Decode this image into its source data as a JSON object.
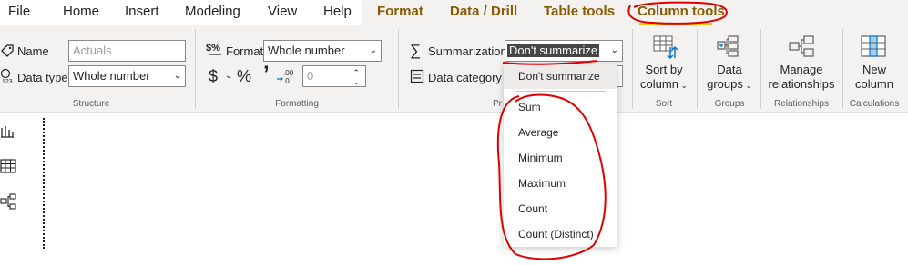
{
  "menu": {
    "tabs": [
      {
        "label": "File"
      },
      {
        "label": "Home"
      },
      {
        "label": "Insert"
      },
      {
        "label": "Modeling"
      },
      {
        "label": "View"
      },
      {
        "label": "Help"
      },
      {
        "label": "Format"
      },
      {
        "label": "Data / Drill"
      },
      {
        "label": "Table tools"
      },
      {
        "label": "Column tools"
      }
    ]
  },
  "structure": {
    "name_label": "Name",
    "name_value": "Actuals",
    "datatype_label": "Data type",
    "datatype_value": "Whole number",
    "group_label": "Structure"
  },
  "formatting": {
    "format_label": "Format",
    "format_value": "Whole number",
    "currency_symbol": "$",
    "percent_symbol": "%",
    "comma_symbol": "’",
    "decimal_symbol": ".00",
    "decimals_value": "0",
    "group_label": "Formatting"
  },
  "properties": {
    "summarization_label": "Summarization",
    "summarization_value": "Don't summarize",
    "category_label": "Data category",
    "group_label": "Pr"
  },
  "sort": {
    "button_label_1": "Sort by",
    "button_label_2": "column",
    "group_label": "Sort"
  },
  "groups": {
    "button_label_1": "Data",
    "button_label_2": "groups",
    "group_label": "Groups"
  },
  "relationships": {
    "button_label_1": "Manage",
    "button_label_2": "relationships",
    "group_label": "Relationships"
  },
  "calculations": {
    "button_label_1": "New",
    "button_label_2": "column",
    "group_label": "Calculations"
  },
  "dropdown": {
    "items": [
      {
        "label": "Don't summarize"
      },
      {
        "label": "Sum"
      },
      {
        "label": "Average"
      },
      {
        "label": "Minimum"
      },
      {
        "label": "Maximum"
      },
      {
        "label": "Count"
      },
      {
        "label": "Count (Distinct)"
      }
    ]
  },
  "colors": {
    "accent_yellow": "#f2c811",
    "annotation_red": "#e00000",
    "ribbon_bg": "#f3f2f1"
  }
}
